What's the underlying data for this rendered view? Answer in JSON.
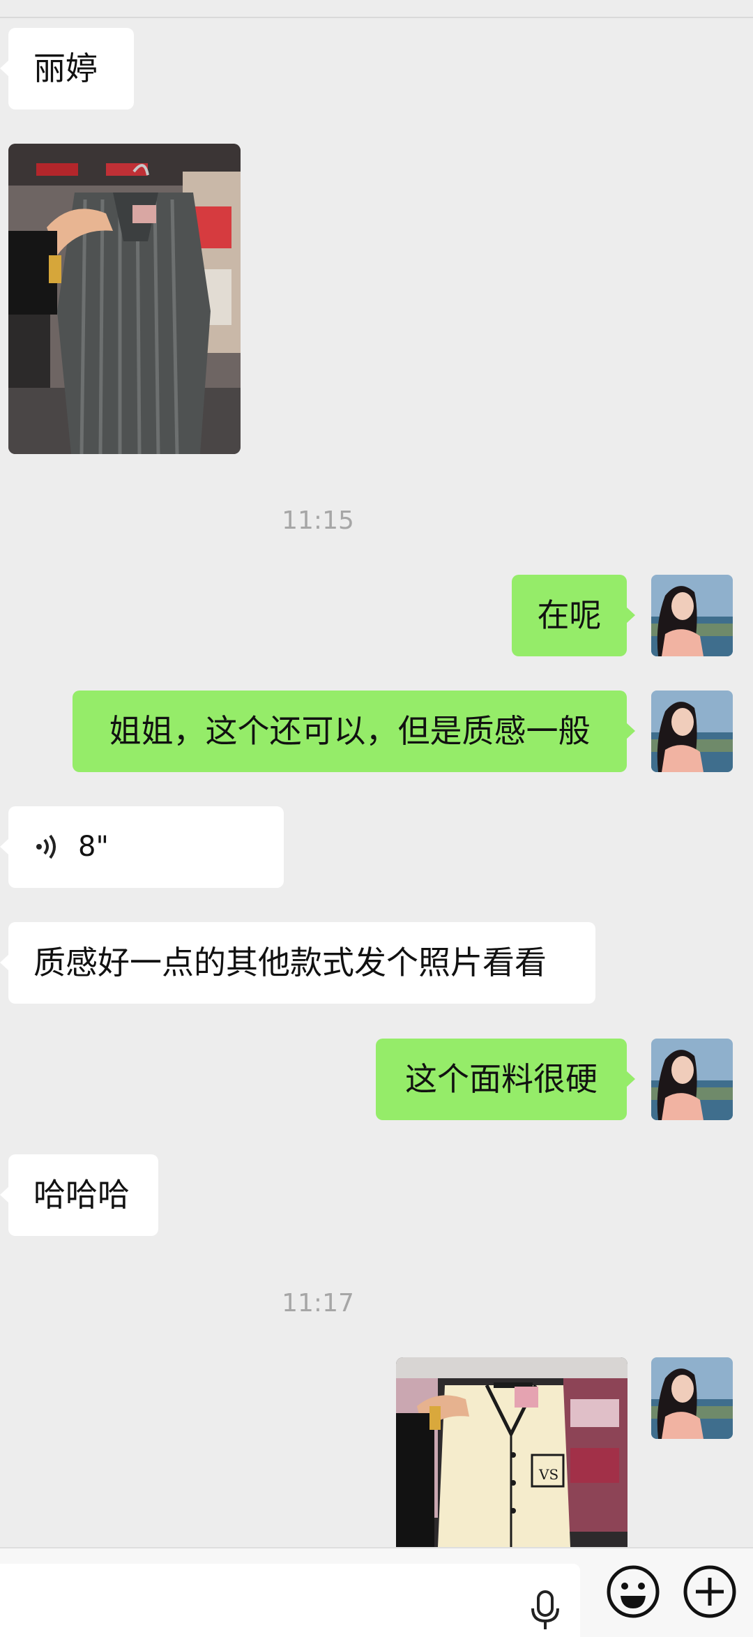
{
  "messages": {
    "m1": "丽婷",
    "ts1": "11:15",
    "m3": "在呢",
    "m4": "姐姐，这个还可以，但是质感一般",
    "voice_duration": "8\"",
    "m6": "质感好一点的其他款式发个照片看看",
    "m7": "这个面料很硬",
    "m8": "哈哈哈",
    "ts2": "11:17"
  },
  "icons": {
    "voice": "voice-wave-icon",
    "mic": "microphone-icon",
    "emoji": "emoji-icon",
    "plus": "plus-icon"
  },
  "colors": {
    "background": "#ededed",
    "incoming_bubble": "#ffffff",
    "outgoing_bubble": "#95ec69",
    "timestamp": "#a6a6a6"
  }
}
